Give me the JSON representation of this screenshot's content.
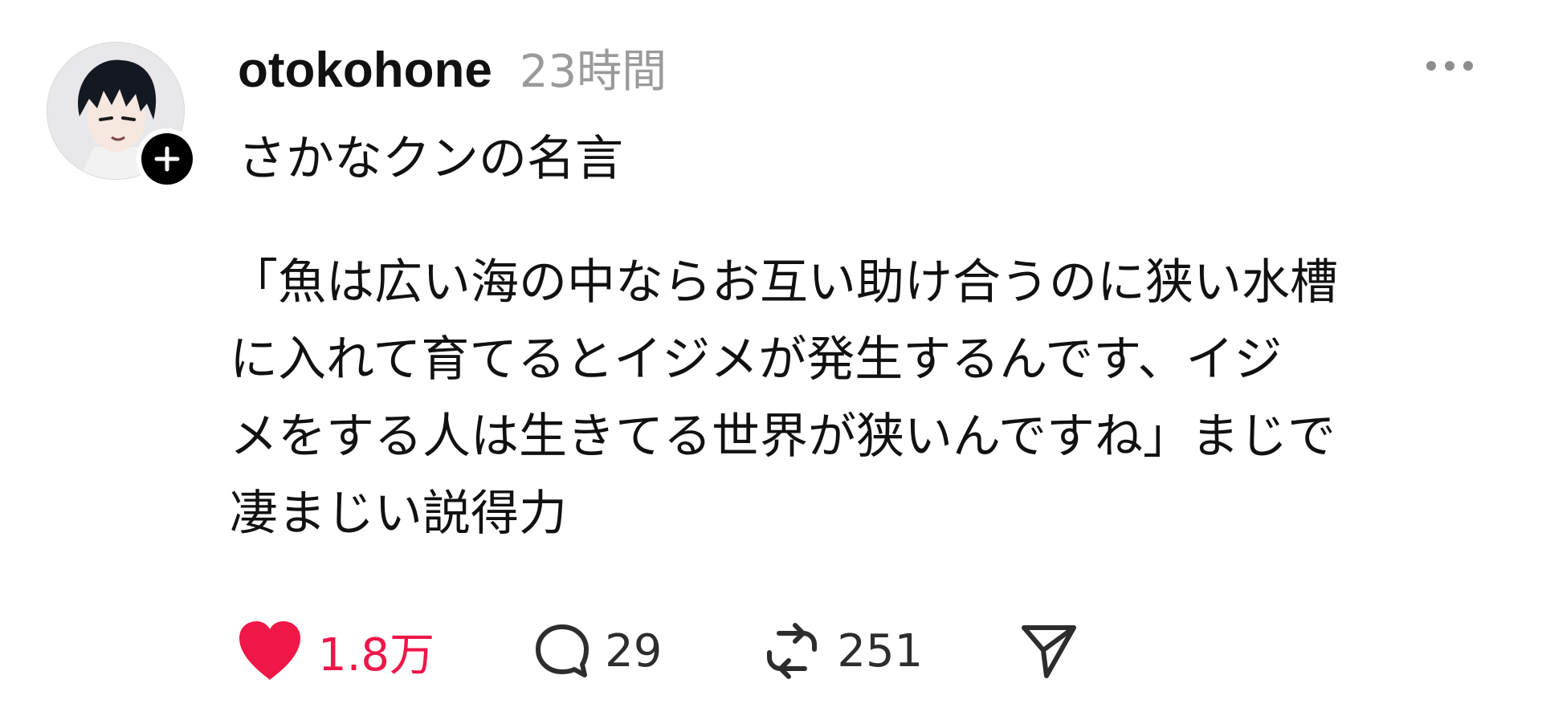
{
  "post": {
    "username": "otokohone",
    "time_ago": "23時間",
    "title": "さかなクンの名言",
    "body_lines": [
      "「魚は広い海の中ならお互い助け合うのに狭い水槽",
      "に入れて育てるとイジメが発生するんです、イジ",
      "メをする人は生きてる世界が狭いんですね」まじで",
      "凄まじい説得力"
    ]
  },
  "actions": {
    "like_count": "1.8万",
    "reply_count": "29",
    "repost_count": "251"
  },
  "icons": {
    "avatar": "avatar-image",
    "follow": "plus-icon",
    "more": "more-icon",
    "like": "heart-icon",
    "reply": "comment-bubble-icon",
    "repost": "repost-icon",
    "share": "send-icon"
  },
  "colors": {
    "like_active": "#ee1748",
    "secondary_text": "#9a9a9a",
    "text": "#111111"
  }
}
